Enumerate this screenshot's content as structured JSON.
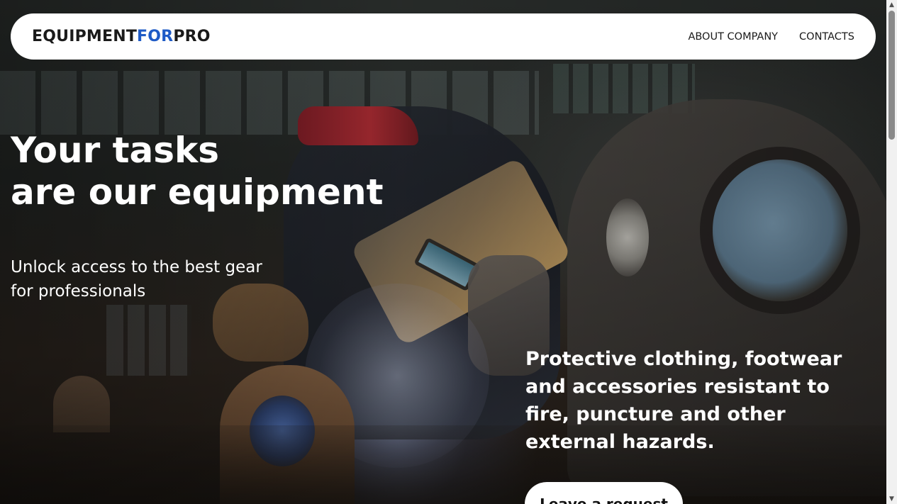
{
  "header": {
    "logo_part1": "EQUIPMENT",
    "logo_part2": "FOR",
    "logo_part3": "PRO",
    "logo_accent_color": "#1f5bc6",
    "nav": [
      {
        "label": "ABOUT COMPANY"
      },
      {
        "label": "CONTACTS"
      }
    ]
  },
  "hero": {
    "title_line1": "Your tasks",
    "title_line2": "are our equipment",
    "subtitle_line1": "Unlock access to the best gear",
    "subtitle_line2": "for professionals",
    "description": "Protective clothing, footwear and accessories resistant to fire, puncture and other external hazards.",
    "cta_label": "Leave a request",
    "background_image": "welder working on metal parts in a workshop"
  },
  "scrollbar": {
    "up_icon": "triangle-up-icon",
    "down_icon": "triangle-down-icon"
  }
}
